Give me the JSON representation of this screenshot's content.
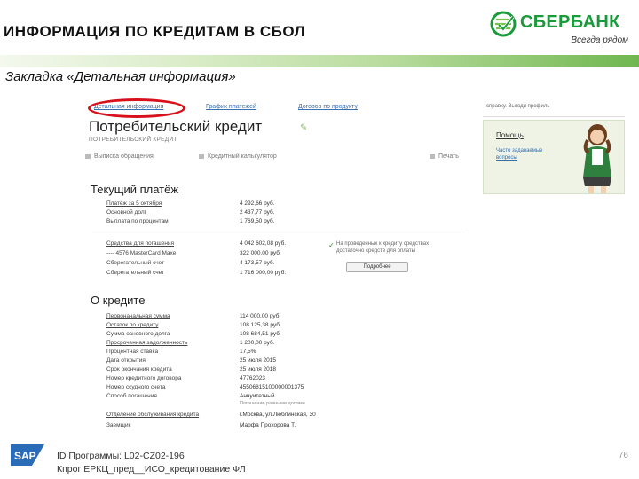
{
  "slide": {
    "title": "ИНФОРМАЦИЯ ПО КРЕДИТАМ В СБОЛ",
    "subtitle": "Закладка «Детальная информация»",
    "brand": {
      "name": "СБЕРБАНК",
      "slogan": "Всегда рядом",
      "color": "#1a9a3a"
    },
    "accent_color": "#d8101c"
  },
  "app": {
    "tabs": [
      {
        "label": "Детальная информация",
        "highlighted": true
      },
      {
        "label": "График платежей"
      },
      {
        "label": "Договор по продукту"
      }
    ],
    "credit_title": "Потребительский кредит",
    "credit_subtitle": "ПОТРЕБИТЕЛЬСКИЙ КРЕДИТ",
    "actions": [
      {
        "label": "Выписка обращения",
        "icon": "print-icon"
      },
      {
        "label": "Кредитный калькулятор",
        "icon": "calculator-icon"
      },
      {
        "label": "Печать",
        "icon": "printer-icon"
      }
    ],
    "current_payment": {
      "heading": "Текущий платёж",
      "rows": [
        {
          "label": "Платёж за 5 октября",
          "value": "4 292,66 руб."
        },
        {
          "label": "Основной долг",
          "value": "2 437,77 руб."
        },
        {
          "label": "Выплата по процентам",
          "value": "1 769,50 руб."
        }
      ],
      "balance_rows": [
        {
          "label": "Средства для погашения",
          "value": "4 042 602,08 руб."
        },
        {
          "label": "---- 4576 MasterCard Maxe",
          "value": "322 000,00 руб."
        },
        {
          "label": "Сберегательный счет",
          "value": "4 173,57 руб."
        },
        {
          "label": "Сберегательный счет",
          "value": "1 716 000,00 руб."
        }
      ],
      "notice": "На проведенных к кредиту средствах достаточно средств для оплаты",
      "notice_button": "Подробнее"
    },
    "about": {
      "heading": "О кредите",
      "rows": [
        {
          "label": "Первоначальная сумма",
          "value": "114 000,00 руб."
        },
        {
          "label": "Остаток по кредиту",
          "value": "108 125,38 руб."
        },
        {
          "label": "Сумма основного долга",
          "value": "108 684,51 руб."
        },
        {
          "label": "Просроченная задолженность",
          "value": "1 200,00 руб."
        },
        {
          "label": "Процентная ставка",
          "value": "17,5%"
        },
        {
          "label": "Дата открытия",
          "value": "25 июля 2015"
        },
        {
          "label": "Срок окончания кредита",
          "value": "25 июля 2018"
        },
        {
          "label": "Номер кредитного договора",
          "value": "47762023"
        },
        {
          "label": "Номер ссудного счета",
          "value": "45506815100000001375"
        },
        {
          "label": "Способ погашения",
          "value": "Аннуитетный"
        },
        {
          "label": "",
          "value": "Погашение равными долями"
        },
        {
          "label": "Отделение обслуживания кредита",
          "value": "г.Москва, ул.Люблинская, 30"
        },
        {
          "label": "Заемщик",
          "value": "Марфа Прохорова Т."
        }
      ]
    },
    "right_panel": {
      "top_link": "справку. Выгоди профиль",
      "help_title": "Помощь",
      "help_link": "Часто задаваемые вопросы"
    }
  },
  "footer": {
    "program_id": "ID Программы: L02-CZ02-196",
    "program_name": "Кпрог ЕРКЦ_пред__ИСО_кредитование ФЛ",
    "page_number": "76",
    "sap_logo": "SAP"
  }
}
